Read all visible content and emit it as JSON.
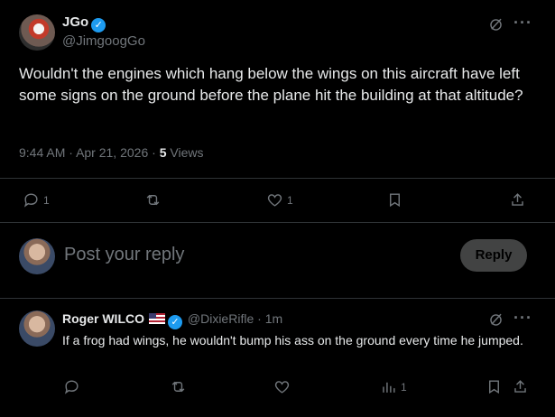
{
  "main_post": {
    "author_name": "JGo",
    "author_handle": "@JimgoogGo",
    "text": "Wouldn't the engines which hang below the wings on this aircraft have left some signs on the ground before the plane hit the building at that altitude?",
    "time": "9:44 AM",
    "date": "Apr 21, 2026",
    "separator": "·",
    "views_count": "5",
    "views_label": "Views",
    "replies": "1",
    "likes": "1"
  },
  "composer": {
    "placeholder": "Post your reply",
    "button_label": "Reply"
  },
  "reply_post": {
    "author_name": "Roger WILCO",
    "author_handle": "@DixieRifle",
    "separator": "·",
    "time_ago": "1m",
    "text": "If a frog had wings, he wouldn't bump his ass on the ground every time he jumped.",
    "views": "1"
  },
  "colors": {
    "background": "#000000",
    "text": "#e7e9ea",
    "muted": "#71767b",
    "verified": "#1d9bf0",
    "divider": "#2f3336"
  }
}
